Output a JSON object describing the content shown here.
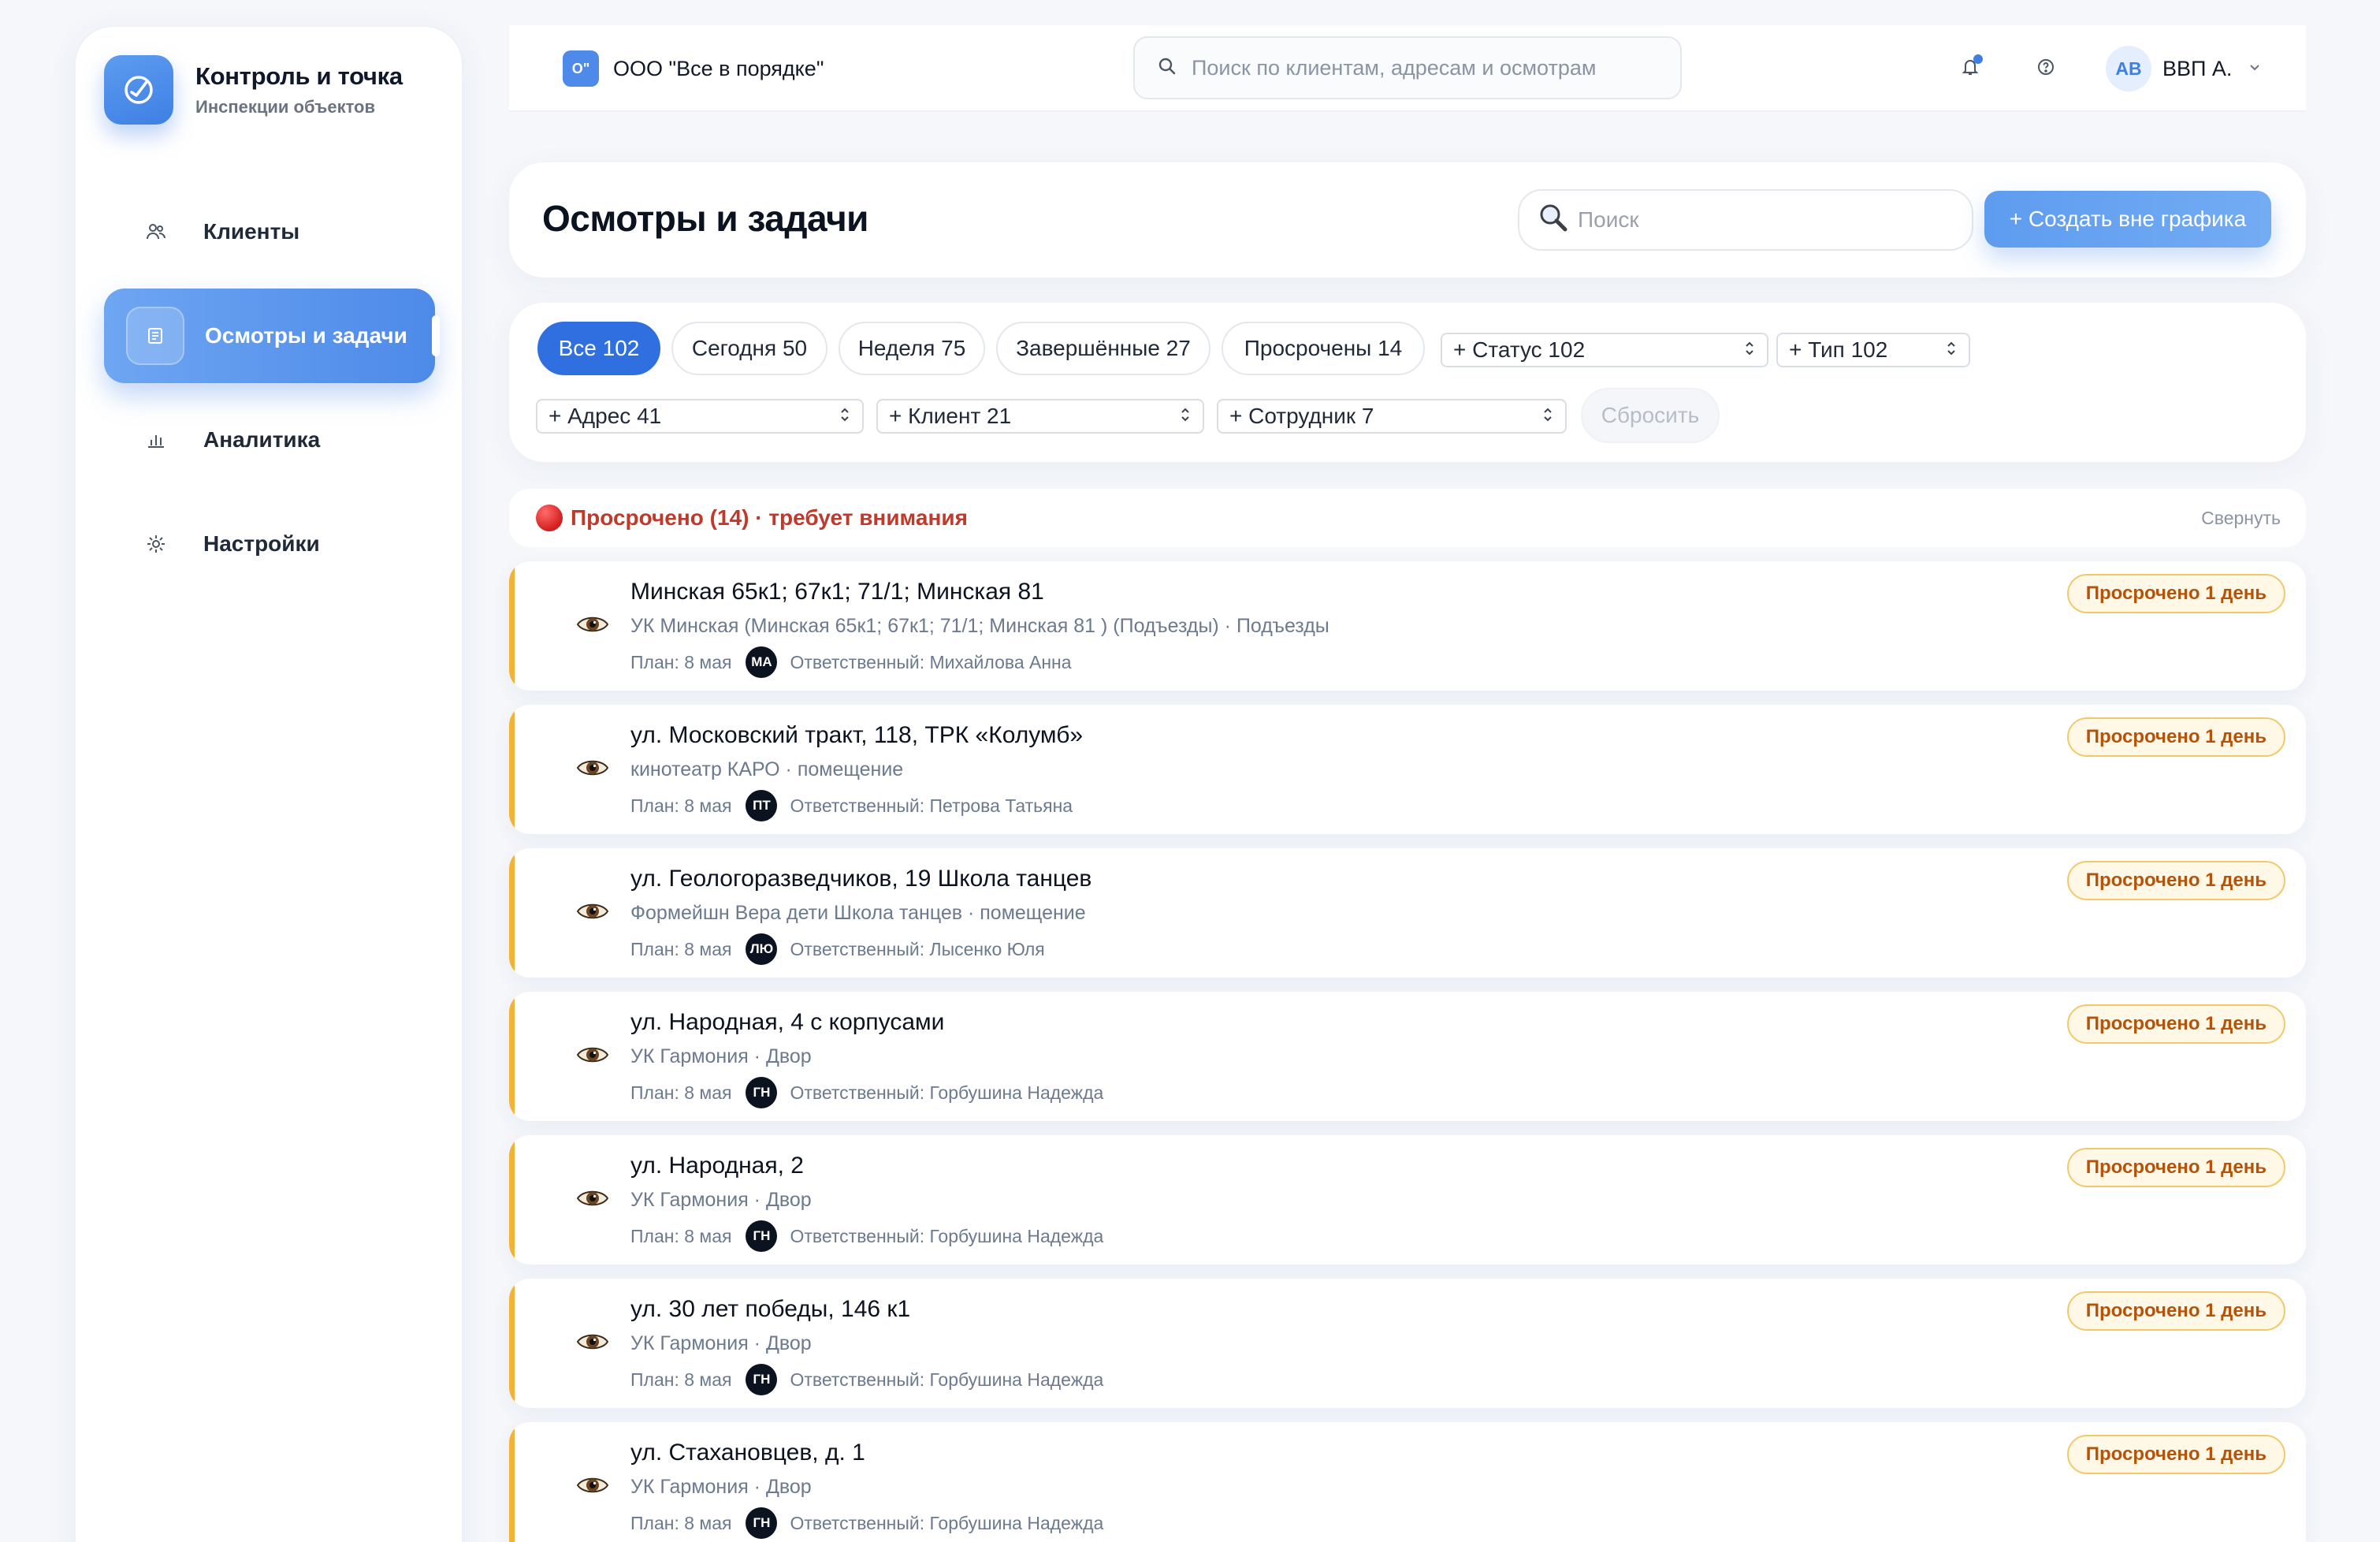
{
  "brand": {
    "title": "Контроль и точка",
    "subtitle": "Инспекции объектов"
  },
  "sidebar": {
    "items": [
      {
        "label": "Клиенты",
        "icon": "users-icon"
      },
      {
        "label": "Осмотры и задачи",
        "icon": "list-icon",
        "active": true
      },
      {
        "label": "Аналитика",
        "icon": "bar-chart-icon"
      },
      {
        "label": "Настройки",
        "icon": "gear-icon"
      }
    ]
  },
  "topbar": {
    "org_logo": "O\"",
    "org_name": "ООО \"Все в порядке\"",
    "search_placeholder": "Поиск по клиентам, адресам и осмотрам",
    "user_initials": "АВ",
    "user_name": "ВВП А."
  },
  "header": {
    "title": "Осмотры и задачи",
    "search_placeholder": "Поиск",
    "create_label": "+ Создать вне графика"
  },
  "filters": {
    "chips": [
      {
        "label": "Все 102",
        "active": true
      },
      {
        "label": "Сегодня 50"
      },
      {
        "label": "Неделя 75"
      },
      {
        "label": "Завершённые 27"
      },
      {
        "label": "Просрочены 14"
      }
    ],
    "selects": [
      "+ Статус 102",
      "+ Тип 102",
      "+ Адрес 41",
      "+ Клиент 21",
      "+ Сотрудник 7"
    ],
    "reset_label": "Сбросить"
  },
  "group": {
    "title": "Просрочено (14) · требует внимания",
    "collapse_label": "Свернуть",
    "accent": "#c0392b"
  },
  "tasks": [
    {
      "title": "Минская 65к1; 67к1; 71/1; Минская 81",
      "subtitle": "УК Минская (Минская 65к1; 67к1; 71/1; Минская 81 ) (Подъезды) · Подъезды",
      "plan": "План: 8 мая",
      "initials": "МА",
      "responsible": "Ответственный: Михайлова Анна",
      "badge": "Просрочено 1 день"
    },
    {
      "title": "ул. Московский тракт, 118, ТРК «Колумб»",
      "subtitle": "кинотеатр КАРО · помещение",
      "plan": "План: 8 мая",
      "initials": "ПТ",
      "responsible": "Ответственный: Петрова Татьяна",
      "badge": "Просрочено 1 день"
    },
    {
      "title": "ул. Геологоразведчиков, 19 Школа танцев",
      "subtitle": "Формейшн Вера дети Школа танцев · помещение",
      "plan": "План: 8 мая",
      "initials": "ЛЮ",
      "responsible": "Ответственный: Лысенко Юля",
      "badge": "Просрочено 1 день"
    },
    {
      "title": "ул. Народная, 4 с корпусами",
      "subtitle": "УК Гармония · Двор",
      "plan": "План: 8 мая",
      "initials": "ГН",
      "responsible": "Ответственный: Горбушина Надежда",
      "badge": "Просрочено 1 день"
    },
    {
      "title": "ул. Народная, 2",
      "subtitle": "УК Гармония · Двор",
      "plan": "План: 8 мая",
      "initials": "ГН",
      "responsible": "Ответственный: Горбушина Надежда",
      "badge": "Просрочено 1 день"
    },
    {
      "title": "ул. 30 лет победы, 146 к1",
      "subtitle": "УК Гармония · Двор",
      "plan": "План: 8 мая",
      "initials": "ГН",
      "responsible": "Ответственный: Горбушина Надежда",
      "badge": "Просрочено 1 день"
    },
    {
      "title": "ул. Стахановцев, д. 1",
      "subtitle": "УК Гармония · Двор",
      "plan": "План: 8 мая",
      "initials": "ГН",
      "responsible": "Ответственный: Горбушина Надежда",
      "badge": "Просрочено 1 день"
    }
  ],
  "colors": {
    "accent": "#4d8ae9",
    "overdue_bar": "#f2b337",
    "badge_text": "#b45309"
  }
}
